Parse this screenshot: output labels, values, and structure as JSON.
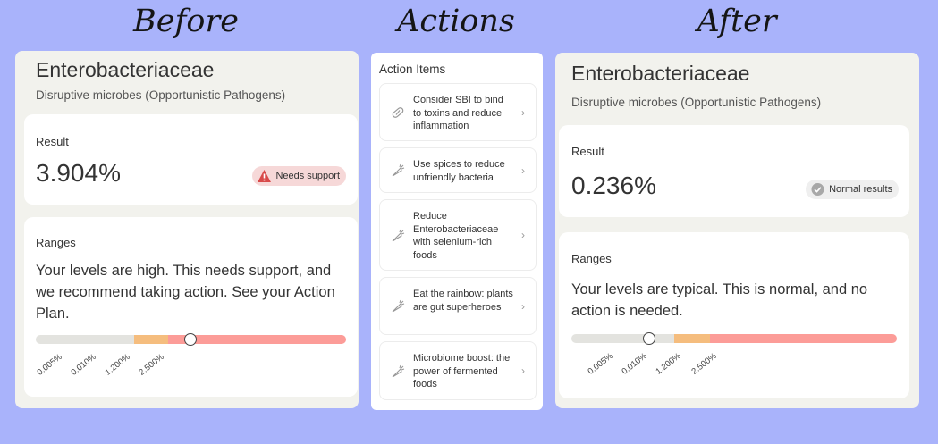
{
  "headings": {
    "before": "Before",
    "actions": "Actions",
    "after": "After"
  },
  "before": {
    "title": "Enterobacteriaceae",
    "subtitle": "Disruptive microbes (Opportunistic Pathogens)",
    "result_label": "Result",
    "result_value": "3.904%",
    "badge": "Needs support",
    "ranges_label": "Ranges",
    "ranges_text": "Your levels are high. This needs support, and we recommend taking action. See your Action Plan.",
    "ticks": [
      "0.005%",
      "0.010%",
      "1.200%",
      "2.500%"
    ]
  },
  "actions": {
    "title": "Action Items",
    "items": [
      {
        "label": "Consider SBI to bind to toxins and reduce inflammation",
        "icon": "pill-icon"
      },
      {
        "label": "Use spices to reduce unfriendly bacteria",
        "icon": "carrot-icon"
      },
      {
        "label": "Reduce Enterobacteriaceae with selenium-rich foods",
        "icon": "carrot-icon"
      },
      {
        "label": "Eat the rainbow: plants are gut superheroes",
        "icon": "carrot-icon"
      },
      {
        "label": "Microbiome boost: the power of fermented foods",
        "icon": "carrot-icon"
      }
    ]
  },
  "after": {
    "title": "Enterobacteriaceae",
    "subtitle": "Disruptive microbes (Opportunistic Pathogens)",
    "result_label": "Result",
    "result_value": "0.236%",
    "badge": "Normal results",
    "ranges_label": "Ranges",
    "ranges_text": "Your levels are typical. This is normal, and no action is needed.",
    "ticks": [
      "0.005%",
      "0.010%",
      "1.200%",
      "2.500%"
    ]
  },
  "colors": {
    "background": "#a9b3fb",
    "range_normal": "#e3e3df",
    "range_elevated": "#f5bd7e",
    "range_high": "#fc9c98",
    "warning_badge": "#f6d8d8",
    "warning_icon": "#d84a4a",
    "ok_icon": "#a8a8a8"
  }
}
